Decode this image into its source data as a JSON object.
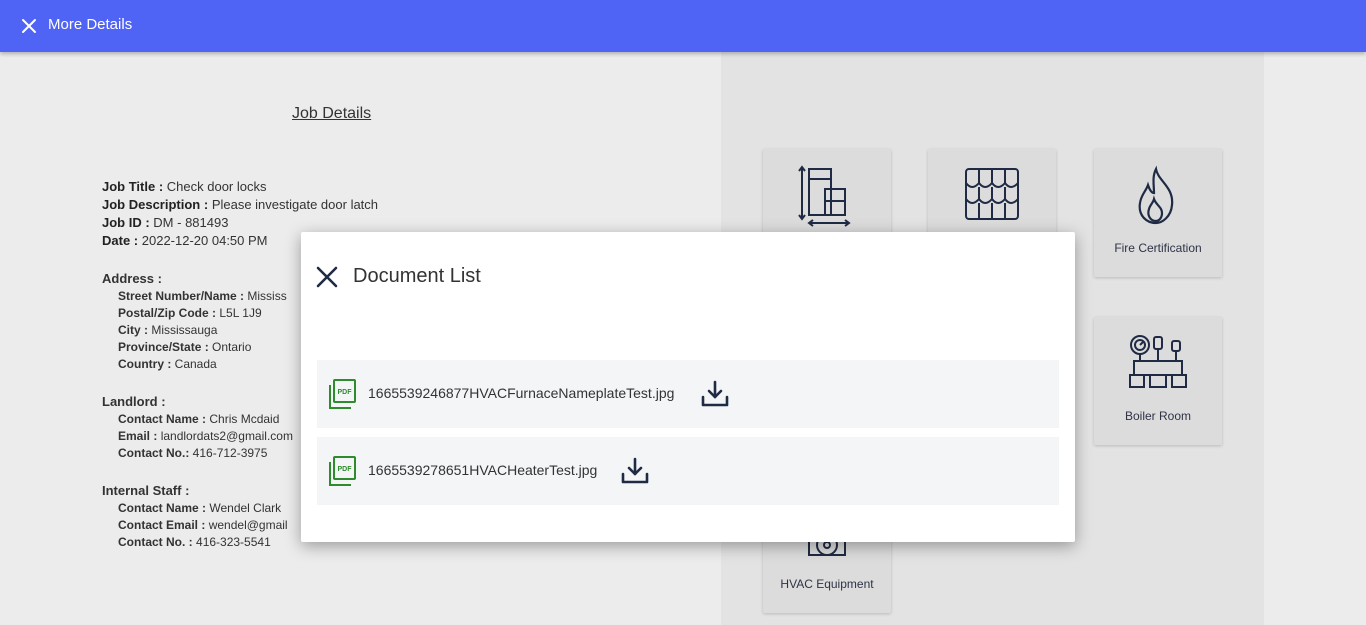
{
  "header": {
    "title": "More Details",
    "close_icon": "close-icon"
  },
  "job": {
    "heading": "Job Details",
    "title_label": "Job Title :",
    "title_value": "Check door locks",
    "desc_label": "Job Description :",
    "desc_value": "Please investigate door latch",
    "id_label": "Job ID :",
    "id_value": "DM - 881493",
    "date_label": "Date :",
    "date_value": "2022-12-20 04:50 PM"
  },
  "address": {
    "heading": "Address :",
    "street_label": "Street Number/Name :",
    "street_value": "Mississ",
    "postal_label": "Postal/Zip Code :",
    "postal_value": "L5L 1J9",
    "city_label": "City :",
    "city_value": "Mississauga",
    "province_label": "Province/State :",
    "province_value": "Ontario",
    "country_label": "Country :",
    "country_value": "Canada"
  },
  "landlord": {
    "heading": "Landlord :",
    "name_label": "Contact Name :",
    "name_value": "Chris Mcdaid",
    "email_label": "Email :",
    "email_value": "landlordats2@gmail.com",
    "phone_label": "Contact No.:",
    "phone_value": "416-712-3975"
  },
  "staff": {
    "heading": "Internal Staff :",
    "name_label": "Contact Name :",
    "name_value": "Wendel Clark",
    "email_label": "Contact Email :",
    "email_value": "wendel@gmail",
    "phone_label": "Contact No. :",
    "phone_value": "416-323-5541"
  },
  "tiles": [
    {
      "label": "",
      "icon": "window-door-icon"
    },
    {
      "label": "",
      "icon": "roof-shingles-icon"
    },
    {
      "label": "Fire Certification",
      "icon": "fire-icon"
    },
    {
      "label": "Boiler Room",
      "icon": "boiler-icon"
    },
    {
      "label": "HVAC Equipment",
      "icon": "hvac-icon"
    }
  ],
  "modal": {
    "title": "Document List",
    "documents": [
      {
        "name": "1665539246877HVACFurnaceNameplateTest.jpg",
        "icon": "pdf-icon",
        "action_icon": "download-icon"
      },
      {
        "name": "1665539278651HVACHeaterTest.jpg",
        "icon": "pdf-icon",
        "action_icon": "download-icon"
      }
    ]
  },
  "colors": {
    "header": "#4f63f5",
    "pdf_icon": "#2e8b2e",
    "icon_dark": "#1f2a44"
  }
}
